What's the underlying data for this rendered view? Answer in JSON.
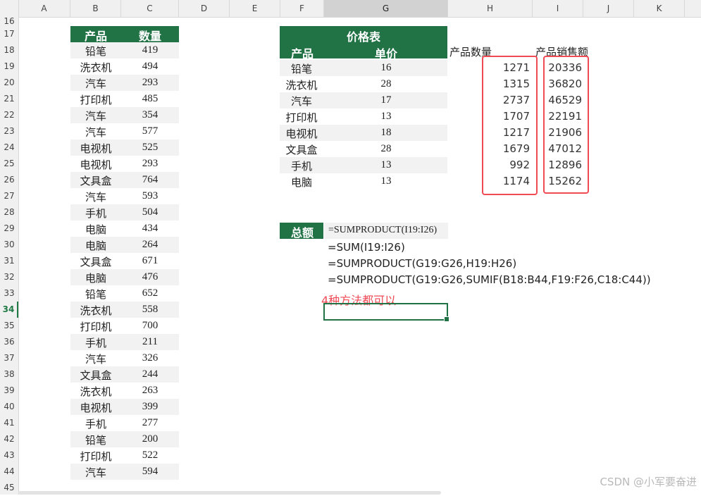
{
  "columns": [
    "A",
    "B",
    "C",
    "D",
    "E",
    "F",
    "G",
    "H",
    "I",
    "J",
    "K"
  ],
  "rows": [
    "16",
    "17",
    "18",
    "19",
    "20",
    "21",
    "22",
    "23",
    "24",
    "25",
    "26",
    "27",
    "28",
    "29",
    "30",
    "31",
    "32",
    "33",
    "34",
    "35",
    "36",
    "37",
    "38",
    "39",
    "40",
    "41",
    "42",
    "43",
    "44",
    "45"
  ],
  "left_table": {
    "header_product": "产品",
    "header_qty": "数量",
    "rows": [
      {
        "product": "铅笔",
        "qty": "419"
      },
      {
        "product": "洗衣机",
        "qty": "494"
      },
      {
        "product": "汽车",
        "qty": "293"
      },
      {
        "product": "打印机",
        "qty": "485"
      },
      {
        "product": "汽车",
        "qty": "354"
      },
      {
        "product": "汽车",
        "qty": "577"
      },
      {
        "product": "电视机",
        "qty": "525"
      },
      {
        "product": "电视机",
        "qty": "293"
      },
      {
        "product": "文具盒",
        "qty": "764"
      },
      {
        "product": "汽车",
        "qty": "593"
      },
      {
        "product": "手机",
        "qty": "504"
      },
      {
        "product": "电脑",
        "qty": "434"
      },
      {
        "product": "电脑",
        "qty": "264"
      },
      {
        "product": "文具盒",
        "qty": "671"
      },
      {
        "product": "电脑",
        "qty": "476"
      },
      {
        "product": "铅笔",
        "qty": "652"
      },
      {
        "product": "洗衣机",
        "qty": "558"
      },
      {
        "product": "打印机",
        "qty": "700"
      },
      {
        "product": "手机",
        "qty": "211"
      },
      {
        "product": "汽车",
        "qty": "326"
      },
      {
        "product": "文具盒",
        "qty": "244"
      },
      {
        "product": "洗衣机",
        "qty": "263"
      },
      {
        "product": "电视机",
        "qty": "399"
      },
      {
        "product": "手机",
        "qty": "277"
      },
      {
        "product": "铅笔",
        "qty": "200"
      },
      {
        "product": "打印机",
        "qty": "522"
      },
      {
        "product": "汽车",
        "qty": "594"
      }
    ]
  },
  "price_table": {
    "title": "价格表",
    "header_product": "产品",
    "header_price": "单价",
    "col_h_label": "产品数量",
    "col_i_label": "产品销售额",
    "rows": [
      {
        "product": "铅笔",
        "price": "16",
        "qty": "1271",
        "sales": "20336"
      },
      {
        "product": "洗衣机",
        "price": "28",
        "qty": "1315",
        "sales": "36820"
      },
      {
        "product": "汽车",
        "price": "17",
        "qty": "2737",
        "sales": "46529"
      },
      {
        "product": "打印机",
        "price": "13",
        "qty": "1707",
        "sales": "22191"
      },
      {
        "product": "电视机",
        "price": "18",
        "qty": "1217",
        "sales": "21906"
      },
      {
        "product": "文具盒",
        "price": "28",
        "qty": "1679",
        "sales": "47012"
      },
      {
        "product": "手机",
        "price": "13",
        "qty": "992",
        "sales": "12896"
      },
      {
        "product": "电脑",
        "price": "13",
        "qty": "1174",
        "sales": "15262"
      }
    ]
  },
  "total": {
    "label": "总额",
    "formulas": [
      "=SUMPRODUCT(I19:I26)",
      "=SUM(I19:I26)",
      "=SUMPRODUCT(G19:G26,H19:H26)",
      "=SUMPRODUCT(G19:G26,SUMIF(B18:B44,F19:F26,C18:C44))"
    ],
    "note": "4种方法都可以"
  },
  "watermark": "CSDN @小军要奋进",
  "colors": {
    "accent_green": "#217346",
    "highlight_red": "#f04a55",
    "band": "#f2f2f2"
  }
}
